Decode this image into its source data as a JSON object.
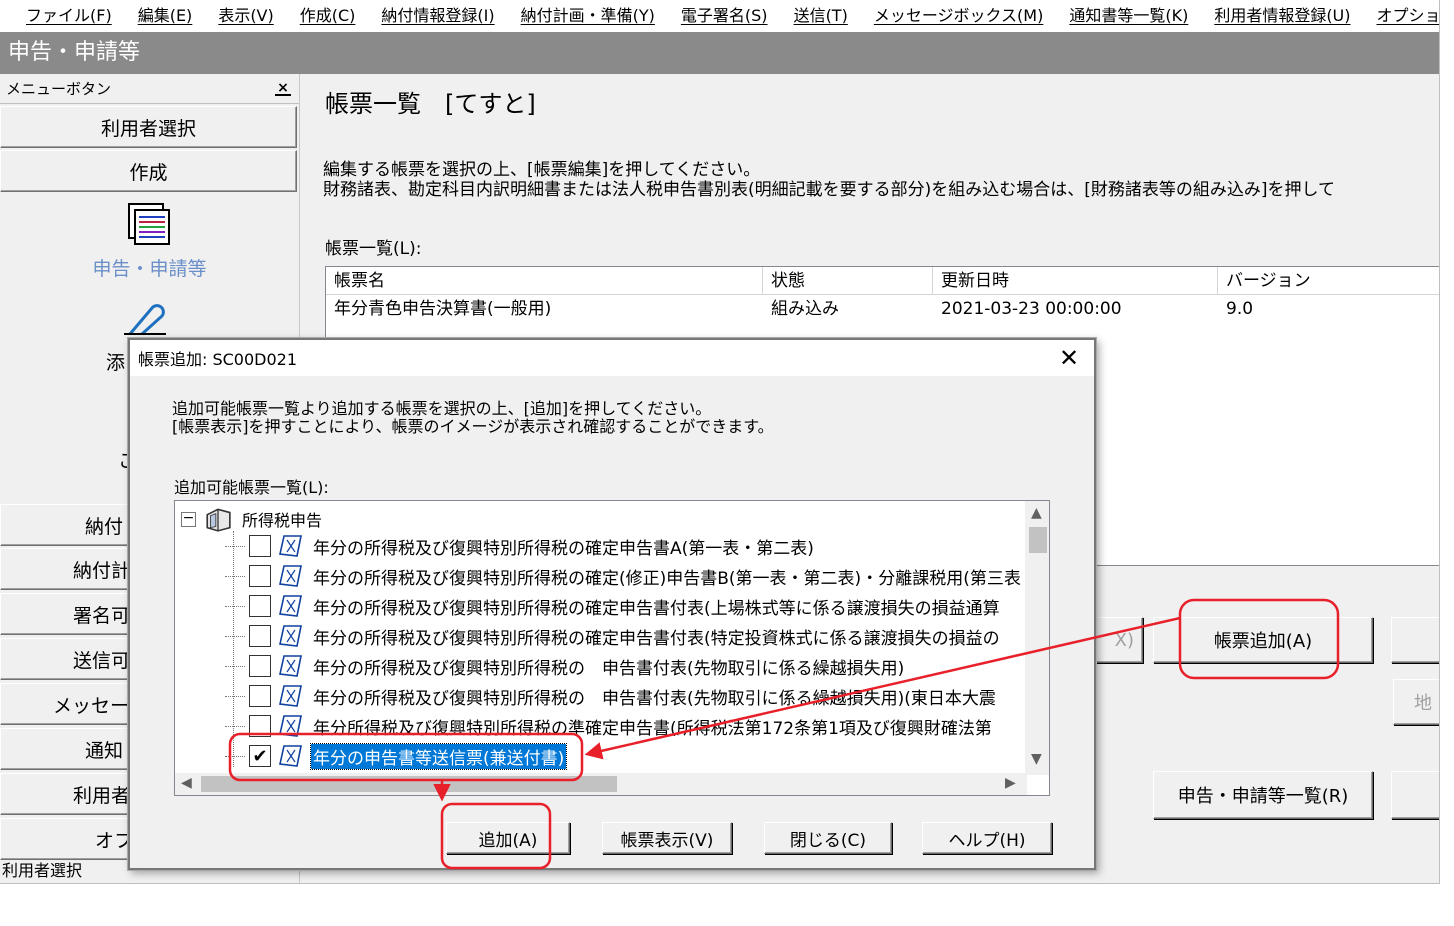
{
  "menubar": {
    "items": [
      "ファイル(F)",
      "編集(E)",
      "表示(V)",
      "作成(C)",
      "納付情報登録(I)",
      "納付計画・準備(Y)",
      "電子署名(S)",
      "送信(T)",
      "メッセージボックス(M)",
      "通知書等一覧(K)",
      "利用者情報登録(U)",
      "オプション(O"
    ]
  },
  "window": {
    "title": "申告・申請等"
  },
  "sidebar": {
    "header": "メニューボタン",
    "close_glyph": "×",
    "buttons": {
      "user_select": "利用者選択",
      "create": "作成"
    },
    "icon_label": "申告・申請等",
    "partial_labels": [
      "添",
      "こ",
      "納付",
      "納付計",
      "署名可",
      "送信可",
      "メッセー",
      "通知",
      "利用者",
      "オフ"
    ],
    "status": "利用者選択"
  },
  "main": {
    "title": "帳票一覧　[てすと]",
    "instruction_line1": "編集する帳票を選択の上、[帳票編集]を押してください。",
    "instruction_line2": "財務諸表、勘定科目内訳明細書または法人税申告書別表(明細記載を要する部分)を組み込む場合は、[財務諸表等の組み込み]を押して",
    "list_label": "帳票一覧(L):",
    "columns": [
      "帳票名",
      "状態",
      "更新日時",
      "バージョン"
    ],
    "rows": [
      {
        "name": "年分青色申告決算書(一般用)",
        "status": "組み込み",
        "updated": "2021-03-23 00:00:00",
        "version": "9.0"
      }
    ],
    "buttons": {
      "add_form": "帳票追加(A)",
      "list": "申告・申請等一覧(R)",
      "partial_left": "X)",
      "partial_right": "地"
    }
  },
  "dialog": {
    "title": "帳票追加: SC00D021",
    "close_glyph": "✕",
    "instruction_line1": "追加可能帳票一覧より追加する帳票を選択の上、[追加]を押してください。",
    "instruction_line2": "[帳票表示]を押すことにより、帳票のイメージが表示され確認することができます。",
    "list_label": "追加可能帳票一覧(L):",
    "tree": {
      "root": "所得税申告",
      "expander": "−",
      "items": [
        {
          "label": "年分の所得税及び復興特別所得税の確定申告書A(第一表・第二表)",
          "checked": false
        },
        {
          "label": "年分の所得税及び復興特別所得税の確定(修正)申告書B(第一表・第二表)・分離課税用(第三表",
          "checked": false
        },
        {
          "label": "年分の所得税及び復興特別所得税の確定申告書付表(上場株式等に係る譲渡損失の損益通算",
          "checked": false
        },
        {
          "label": "年分の所得税及び復興特別所得税の確定申告書付表(特定投資株式に係る譲渡損失の損益の",
          "checked": false
        },
        {
          "label": "年分の所得税及び復興特別所得税の　申告書付表(先物取引に係る繰越損失用)",
          "checked": false
        },
        {
          "label": "年分の所得税及び復興特別所得税の　申告書付表(先物取引に係る繰越損失用)(東日本大震",
          "checked": false
        },
        {
          "label": "年分所得税及び復興特別所得税の準確定申告書(所得税法第172条第1項及び復興財確法第",
          "checked": false
        },
        {
          "label": "年分の申告書等送信票(兼送付書)",
          "checked": true,
          "selected": true
        }
      ],
      "check_glyph": "✔"
    },
    "buttons": {
      "add": "追加(A)",
      "view": "帳票表示(V)",
      "close": "閉じる(C)",
      "help": "ヘルプ(H)"
    }
  },
  "annotation_color": "#e8202a"
}
